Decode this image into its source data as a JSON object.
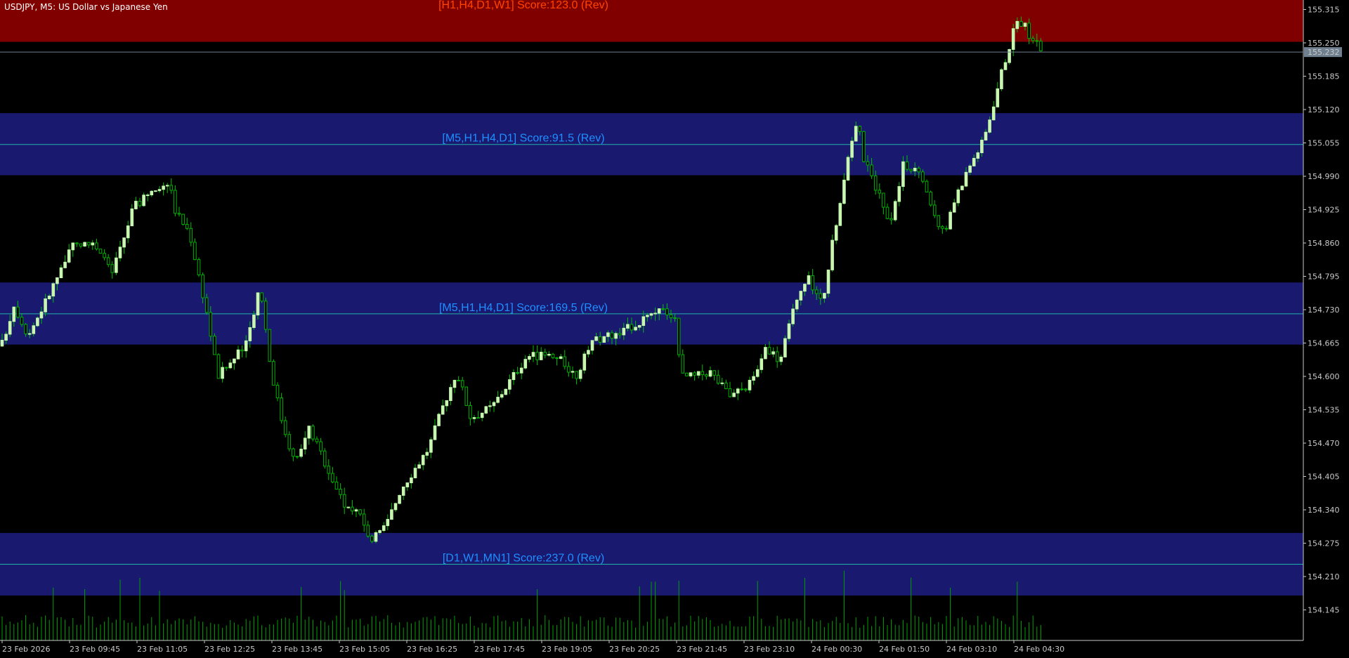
{
  "window": {
    "symbol_title": "USDJPY, M5:  US Dollar vs Japanese Yen"
  },
  "colors": {
    "background": "#000000",
    "bull_candle": "#c8f7b0",
    "bear_candle": "#00b000",
    "wick": "#00c000",
    "volume": "#00a000",
    "resistance_zone": "#800000",
    "support_zone": "#191970",
    "zone_midline": "#20b2aa",
    "resistance_text": "#ff4500",
    "support_text": "#1e90ff",
    "axis": "#c8c8c8",
    "bid_line": "#708090"
  },
  "price_axis": {
    "ticks": [
      "155.315",
      "155.250",
      "155.185",
      "155.120",
      "155.055",
      "154.990",
      "154.925",
      "154.860",
      "154.795",
      "154.730",
      "154.665",
      "154.600",
      "154.535",
      "154.470",
      "154.405",
      "154.340",
      "154.275",
      "154.210",
      "154.145"
    ],
    "current_price": "155.232"
  },
  "time_axis": {
    "labels": [
      "23 Feb 2026",
      "23 Feb 09:45",
      "23 Feb 11:05",
      "23 Feb 12:25",
      "23 Feb 13:45",
      "23 Feb 15:05",
      "23 Feb 16:25",
      "23 Feb 17:45",
      "23 Feb 19:05",
      "23 Feb 20:25",
      "23 Feb 21:45",
      "23 Feb 23:10",
      "24 Feb 00:30",
      "24 Feb 01:50",
      "24 Feb 03:10",
      "24 Feb 04:30"
    ]
  },
  "zones": [
    {
      "kind": "resistance",
      "label": "[H1,H4,D1,W1] Score:123.0 (Rev)",
      "top": 155.335,
      "bottom": 155.252,
      "mid": null
    },
    {
      "kind": "support",
      "label": "[M5,H1,H4,D1] Score:91.5 (Rev)",
      "top": 155.113,
      "bottom": 154.992,
      "mid": 155.052
    },
    {
      "kind": "support",
      "label": "[M5,H1,H4,D1] Score:169.5 (Rev)",
      "top": 154.783,
      "bottom": 154.662,
      "mid": 154.722
    },
    {
      "kind": "support",
      "label": "[D1,W1,MN1] Score:237.0 (Rev)",
      "top": 154.295,
      "bottom": 154.173,
      "mid": 154.234
    }
  ]
}
